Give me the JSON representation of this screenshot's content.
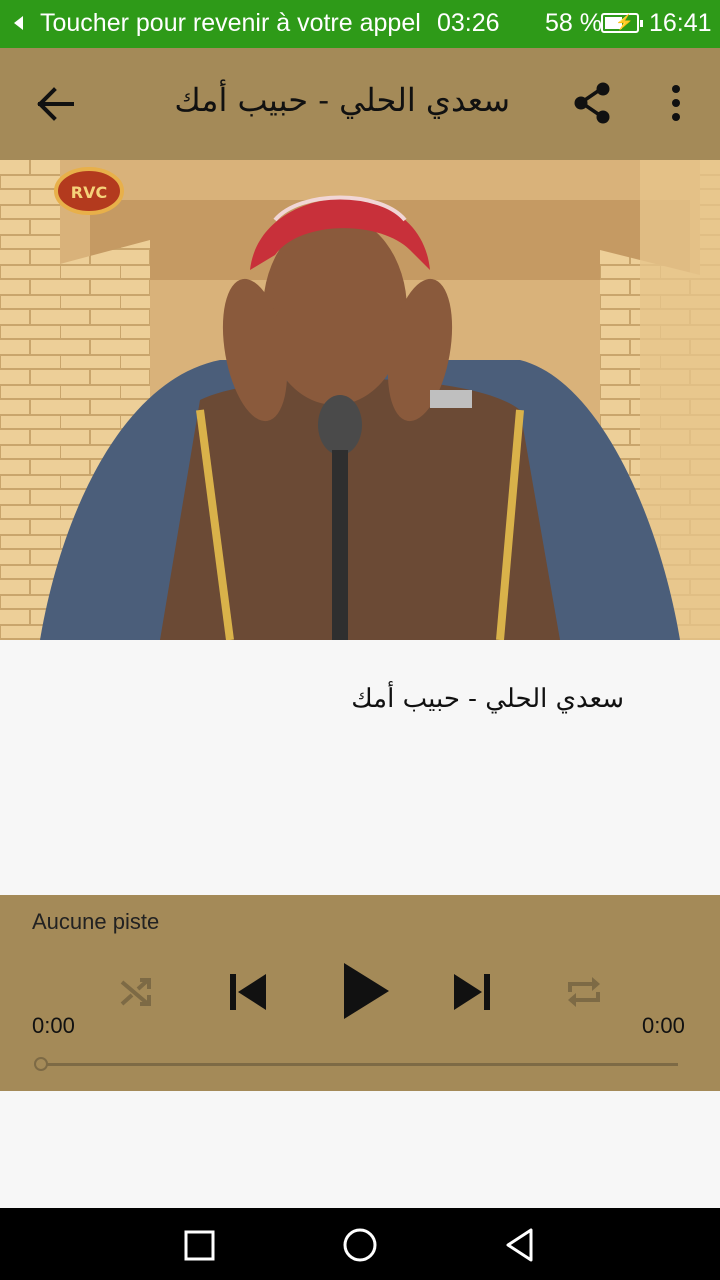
{
  "status_bar": {
    "call_text": "Toucher pour revenir à votre appel",
    "call_timer": "03:26",
    "battery_percent": "58 %",
    "battery_level": 0.58,
    "clock": "16:41",
    "background": "#2e9a18"
  },
  "toolbar": {
    "title": "سعدي الحلي - حبيب أمك",
    "back_icon": "arrow-left-icon",
    "share_icon": "share-icon",
    "more_icon": "more-vertical-icon",
    "background": "#a48a58"
  },
  "hero": {
    "watermark": "RVC"
  },
  "content": {
    "song_title": "سعدي الحلي - حبيب أمك"
  },
  "player": {
    "track_label": "Aucune piste",
    "elapsed": "0:00",
    "duration": "0:00",
    "progress": 0,
    "controls": [
      "shuffle-icon",
      "skip-previous-icon",
      "play-icon",
      "skip-next-icon",
      "repeat-icon"
    ],
    "background": "#a48a58"
  },
  "navbar": {
    "buttons": [
      "recents-square-icon",
      "home-circle-icon",
      "back-triangle-icon"
    ]
  }
}
